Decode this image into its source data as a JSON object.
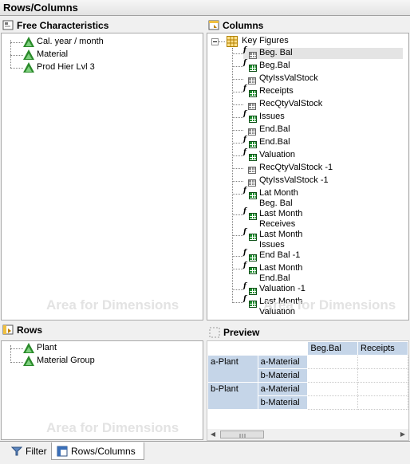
{
  "window": {
    "title": "Rows/Columns"
  },
  "free_characteristics": {
    "title": "Free Characteristics",
    "watermark": "Area for Dimensions",
    "items": [
      {
        "label": "Cal. year / month"
      },
      {
        "label": "Material"
      },
      {
        "label": "Prod Hier Lvl 3"
      }
    ]
  },
  "columns": {
    "title": "Columns",
    "watermark": "Area for Dimensions",
    "root": {
      "label": "Key Figures"
    },
    "items": [
      {
        "label": "Beg. Bal",
        "icon": "formula-keyfigure-grey-icon"
      },
      {
        "label": "Beg.Bal",
        "icon": "formula-keyfigure-icon"
      },
      {
        "label": "QtyIssValStock",
        "icon": "keyfigure-grey-icon"
      },
      {
        "label": "Receipts",
        "icon": "formula-keyfigure-icon"
      },
      {
        "label": "RecQtyValStock",
        "icon": "keyfigure-grey-icon"
      },
      {
        "label": "Issues",
        "icon": "formula-keyfigure-icon"
      },
      {
        "label": "End.Bal",
        "icon": "keyfigure-grey-icon"
      },
      {
        "label": "End.Bal",
        "icon": "formula-keyfigure-icon"
      },
      {
        "label": "Valuation",
        "icon": "formula-keyfigure-icon"
      },
      {
        "label": "RecQtyValStock -1",
        "icon": "keyfigure-grey-icon"
      },
      {
        "label": "QtyIssValStock -1",
        "icon": "keyfigure-grey-icon"
      },
      {
        "label": "Lat Month",
        "label2": "Beg. Bal",
        "icon": "formula-keyfigure-icon"
      },
      {
        "label": "Last Month",
        "label2": "Receives",
        "icon": "formula-keyfigure-icon"
      },
      {
        "label": "Last Month",
        "label2": "Issues",
        "icon": "formula-keyfigure-icon"
      },
      {
        "label": "End Bal -1",
        "icon": "formula-keyfigure-icon"
      },
      {
        "label": "Last Month",
        "label2": "End.Bal",
        "icon": "formula-keyfigure-icon"
      },
      {
        "label": "Valuation -1",
        "icon": "formula-keyfigure-icon"
      },
      {
        "label": "Last Month",
        "label2": "Valuation",
        "icon": "formula-keyfigure-icon"
      }
    ]
  },
  "rows": {
    "title": "Rows",
    "watermark": "Area for Dimensions",
    "items": [
      {
        "label": "Plant"
      },
      {
        "label": "Material Group"
      }
    ]
  },
  "preview": {
    "title": "Preview",
    "col_headers": [
      "Beg.Bal",
      "Receipts"
    ],
    "rows": [
      {
        "group": "a-Plant",
        "sub": [
          "a-Material",
          "b-Material"
        ]
      },
      {
        "group": "b-Plant",
        "sub": [
          "a-Material",
          "b-Material"
        ]
      }
    ]
  },
  "tabs": [
    {
      "label": "Filter",
      "icon": "filter-icon",
      "active": false
    },
    {
      "label": "Rows/Columns",
      "icon": "rows-columns-icon",
      "active": true
    }
  ]
}
